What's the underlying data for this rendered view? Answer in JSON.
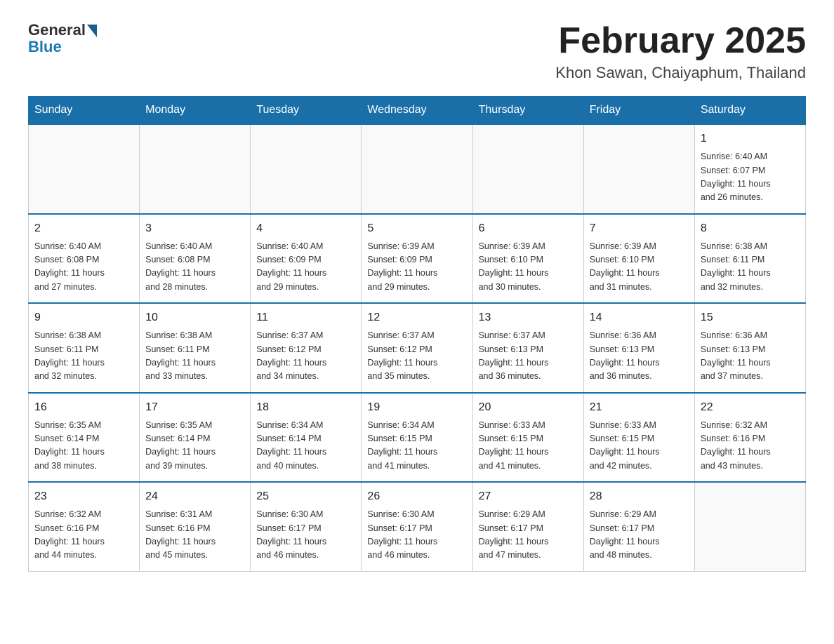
{
  "header": {
    "logo_general": "General",
    "logo_blue": "Blue",
    "title": "February 2025",
    "location": "Khon Sawan, Chaiyaphum, Thailand"
  },
  "weekdays": [
    "Sunday",
    "Monday",
    "Tuesday",
    "Wednesday",
    "Thursday",
    "Friday",
    "Saturday"
  ],
  "weeks": [
    [
      {
        "day": "",
        "info": ""
      },
      {
        "day": "",
        "info": ""
      },
      {
        "day": "",
        "info": ""
      },
      {
        "day": "",
        "info": ""
      },
      {
        "day": "",
        "info": ""
      },
      {
        "day": "",
        "info": ""
      },
      {
        "day": "1",
        "info": "Sunrise: 6:40 AM\nSunset: 6:07 PM\nDaylight: 11 hours\nand 26 minutes."
      }
    ],
    [
      {
        "day": "2",
        "info": "Sunrise: 6:40 AM\nSunset: 6:08 PM\nDaylight: 11 hours\nand 27 minutes."
      },
      {
        "day": "3",
        "info": "Sunrise: 6:40 AM\nSunset: 6:08 PM\nDaylight: 11 hours\nand 28 minutes."
      },
      {
        "day": "4",
        "info": "Sunrise: 6:40 AM\nSunset: 6:09 PM\nDaylight: 11 hours\nand 29 minutes."
      },
      {
        "day": "5",
        "info": "Sunrise: 6:39 AM\nSunset: 6:09 PM\nDaylight: 11 hours\nand 29 minutes."
      },
      {
        "day": "6",
        "info": "Sunrise: 6:39 AM\nSunset: 6:10 PM\nDaylight: 11 hours\nand 30 minutes."
      },
      {
        "day": "7",
        "info": "Sunrise: 6:39 AM\nSunset: 6:10 PM\nDaylight: 11 hours\nand 31 minutes."
      },
      {
        "day": "8",
        "info": "Sunrise: 6:38 AM\nSunset: 6:11 PM\nDaylight: 11 hours\nand 32 minutes."
      }
    ],
    [
      {
        "day": "9",
        "info": "Sunrise: 6:38 AM\nSunset: 6:11 PM\nDaylight: 11 hours\nand 32 minutes."
      },
      {
        "day": "10",
        "info": "Sunrise: 6:38 AM\nSunset: 6:11 PM\nDaylight: 11 hours\nand 33 minutes."
      },
      {
        "day": "11",
        "info": "Sunrise: 6:37 AM\nSunset: 6:12 PM\nDaylight: 11 hours\nand 34 minutes."
      },
      {
        "day": "12",
        "info": "Sunrise: 6:37 AM\nSunset: 6:12 PM\nDaylight: 11 hours\nand 35 minutes."
      },
      {
        "day": "13",
        "info": "Sunrise: 6:37 AM\nSunset: 6:13 PM\nDaylight: 11 hours\nand 36 minutes."
      },
      {
        "day": "14",
        "info": "Sunrise: 6:36 AM\nSunset: 6:13 PM\nDaylight: 11 hours\nand 36 minutes."
      },
      {
        "day": "15",
        "info": "Sunrise: 6:36 AM\nSunset: 6:13 PM\nDaylight: 11 hours\nand 37 minutes."
      }
    ],
    [
      {
        "day": "16",
        "info": "Sunrise: 6:35 AM\nSunset: 6:14 PM\nDaylight: 11 hours\nand 38 minutes."
      },
      {
        "day": "17",
        "info": "Sunrise: 6:35 AM\nSunset: 6:14 PM\nDaylight: 11 hours\nand 39 minutes."
      },
      {
        "day": "18",
        "info": "Sunrise: 6:34 AM\nSunset: 6:14 PM\nDaylight: 11 hours\nand 40 minutes."
      },
      {
        "day": "19",
        "info": "Sunrise: 6:34 AM\nSunset: 6:15 PM\nDaylight: 11 hours\nand 41 minutes."
      },
      {
        "day": "20",
        "info": "Sunrise: 6:33 AM\nSunset: 6:15 PM\nDaylight: 11 hours\nand 41 minutes."
      },
      {
        "day": "21",
        "info": "Sunrise: 6:33 AM\nSunset: 6:15 PM\nDaylight: 11 hours\nand 42 minutes."
      },
      {
        "day": "22",
        "info": "Sunrise: 6:32 AM\nSunset: 6:16 PM\nDaylight: 11 hours\nand 43 minutes."
      }
    ],
    [
      {
        "day": "23",
        "info": "Sunrise: 6:32 AM\nSunset: 6:16 PM\nDaylight: 11 hours\nand 44 minutes."
      },
      {
        "day": "24",
        "info": "Sunrise: 6:31 AM\nSunset: 6:16 PM\nDaylight: 11 hours\nand 45 minutes."
      },
      {
        "day": "25",
        "info": "Sunrise: 6:30 AM\nSunset: 6:17 PM\nDaylight: 11 hours\nand 46 minutes."
      },
      {
        "day": "26",
        "info": "Sunrise: 6:30 AM\nSunset: 6:17 PM\nDaylight: 11 hours\nand 46 minutes."
      },
      {
        "day": "27",
        "info": "Sunrise: 6:29 AM\nSunset: 6:17 PM\nDaylight: 11 hours\nand 47 minutes."
      },
      {
        "day": "28",
        "info": "Sunrise: 6:29 AM\nSunset: 6:17 PM\nDaylight: 11 hours\nand 48 minutes."
      },
      {
        "day": "",
        "info": ""
      }
    ]
  ]
}
